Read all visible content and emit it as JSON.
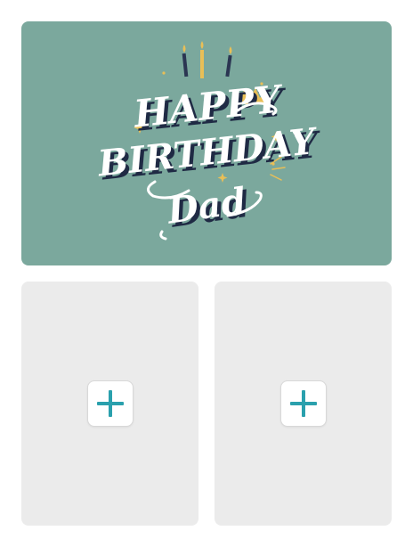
{
  "card": {
    "background": "#7ba89d",
    "line1": "HAPPY",
    "line2": "BIRTHDAY",
    "line3": "Dad",
    "text_color": "#ffffff",
    "shadow_color": "#1f2a44",
    "accent_color": "#e9bf57"
  },
  "slots": [
    {
      "icon": "plus-icon"
    },
    {
      "icon": "plus-icon"
    }
  ],
  "colors": {
    "slot_background": "#ebebeb",
    "plus_color": "#2aa0ad"
  }
}
